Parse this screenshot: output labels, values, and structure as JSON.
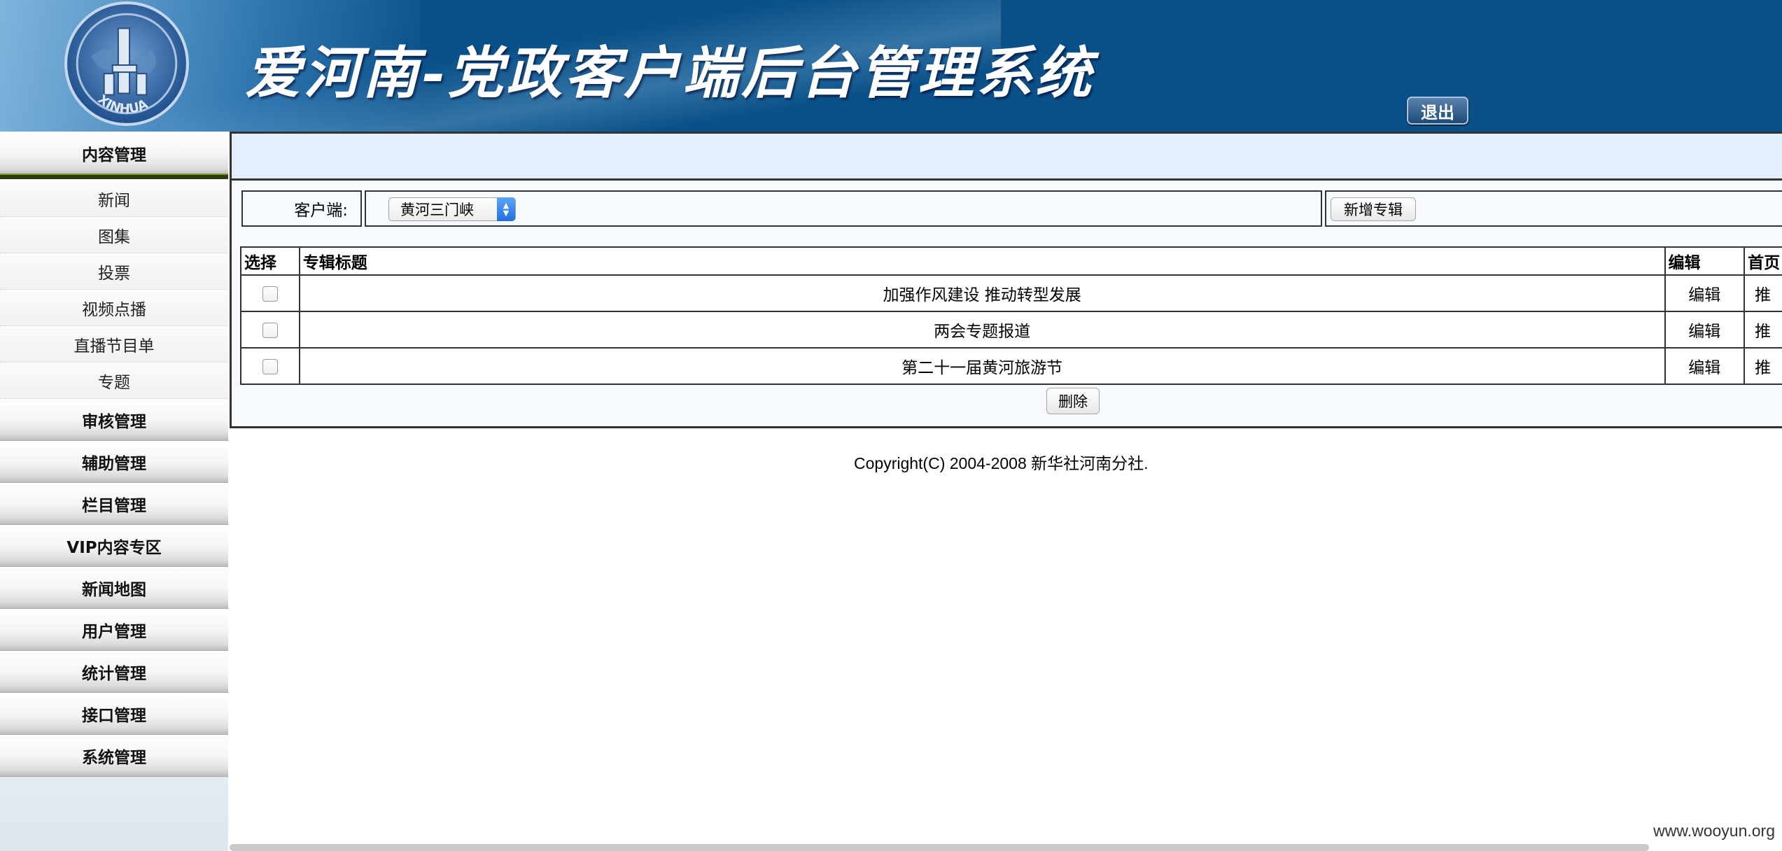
{
  "header": {
    "logo_text": "XINHUA",
    "title": "爱河南-党政客户端后台管理系统",
    "logout_label": "退出"
  },
  "sidebar": {
    "active_menu": "内容管理",
    "submenu": [
      "新闻",
      "图集",
      "投票",
      "视频点播",
      "直播节目单",
      "专题"
    ],
    "menus": [
      "审核管理",
      "辅助管理",
      "栏目管理",
      "VIP内容专区",
      "新闻地图",
      "用户管理",
      "统计管理",
      "接口管理",
      "系统管理"
    ]
  },
  "filter": {
    "client_label": "客户端:",
    "client_selected": "黄河三门峡",
    "add_button": "新增专辑"
  },
  "table": {
    "headers": [
      "选择",
      "专辑标题",
      "编辑",
      "首页"
    ],
    "rows": [
      {
        "title": "加强作风建设 推动转型发展",
        "edit": "编辑",
        "home": "推"
      },
      {
        "title": "两会专题报道",
        "edit": "编辑",
        "home": "推"
      },
      {
        "title": "第二十一届黄河旅游节",
        "edit": "编辑",
        "home": "推"
      }
    ],
    "delete_button": "删除"
  },
  "footer": {
    "copyright": "Copyright(C) 2004-2008 新华社河南分社."
  },
  "watermark": "www.wooyun.org",
  "colors": {
    "header_bg": "#0a5189",
    "panel_bg": "#f6f9fd",
    "top_bar_bg": "#e4eefc"
  }
}
